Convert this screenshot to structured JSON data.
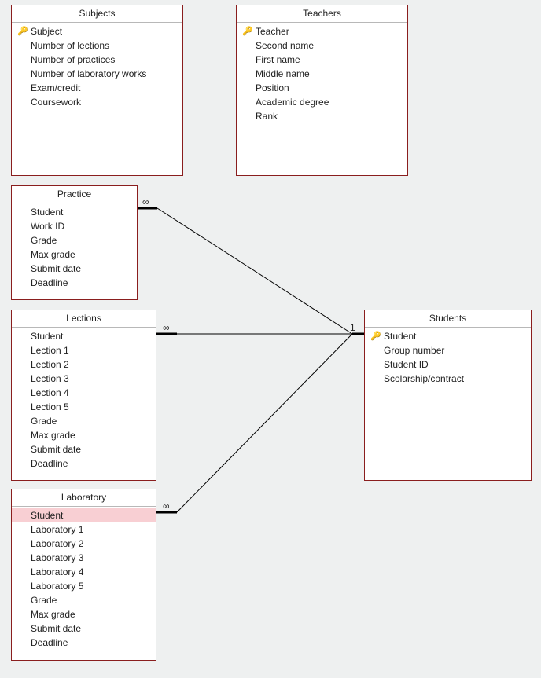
{
  "entities": {
    "subjects": {
      "title": "Subjects",
      "fields": [
        {
          "label": "Subject",
          "pk": true
        },
        {
          "label": "Number of lections"
        },
        {
          "label": "Number of practices"
        },
        {
          "label": "Number of laboratory works"
        },
        {
          "label": "Exam/credit"
        },
        {
          "label": "Coursework"
        }
      ]
    },
    "teachers": {
      "title": "Teachers",
      "fields": [
        {
          "label": "Teacher",
          "pk": true
        },
        {
          "label": "Second name"
        },
        {
          "label": "First name"
        },
        {
          "label": "Middle name"
        },
        {
          "label": "Position"
        },
        {
          "label": "Academic degree"
        },
        {
          "label": "Rank"
        }
      ]
    },
    "practice": {
      "title": "Practice",
      "fields": [
        {
          "label": "Student"
        },
        {
          "label": "Work ID"
        },
        {
          "label": "Grade"
        },
        {
          "label": "Max grade"
        },
        {
          "label": "Submit date"
        },
        {
          "label": "Deadline"
        }
      ]
    },
    "lections": {
      "title": "Lections",
      "fields": [
        {
          "label": "Student"
        },
        {
          "label": "Lection 1"
        },
        {
          "label": "Lection 2"
        },
        {
          "label": "Lection 3"
        },
        {
          "label": "Lection 4"
        },
        {
          "label": "Lection 5"
        },
        {
          "label": "Grade"
        },
        {
          "label": "Max grade"
        },
        {
          "label": "Submit date"
        },
        {
          "label": "Deadline"
        }
      ]
    },
    "laboratory": {
      "title": "Laboratory",
      "fields": [
        {
          "label": "Student",
          "highlight": true
        },
        {
          "label": "Laboratory 1"
        },
        {
          "label": "Laboratory 2"
        },
        {
          "label": "Laboratory 3"
        },
        {
          "label": "Laboratory 4"
        },
        {
          "label": "Laboratory 5"
        },
        {
          "label": "Grade"
        },
        {
          "label": "Max grade"
        },
        {
          "label": "Submit date"
        },
        {
          "label": "Deadline"
        }
      ]
    },
    "students": {
      "title": "Students",
      "fields": [
        {
          "label": "Student",
          "pk": true
        },
        {
          "label": "Group number"
        },
        {
          "label": "Student ID"
        },
        {
          "label": "Scolarship/contract"
        }
      ]
    }
  },
  "relationships": [
    {
      "from": "practice",
      "to": "students",
      "many_label": "∞",
      "one_label": "1"
    },
    {
      "from": "lections",
      "to": "students",
      "many_label": "∞",
      "one_label": "1"
    },
    {
      "from": "laboratory",
      "to": "students",
      "many_label": "∞",
      "one_label": "1"
    }
  ]
}
